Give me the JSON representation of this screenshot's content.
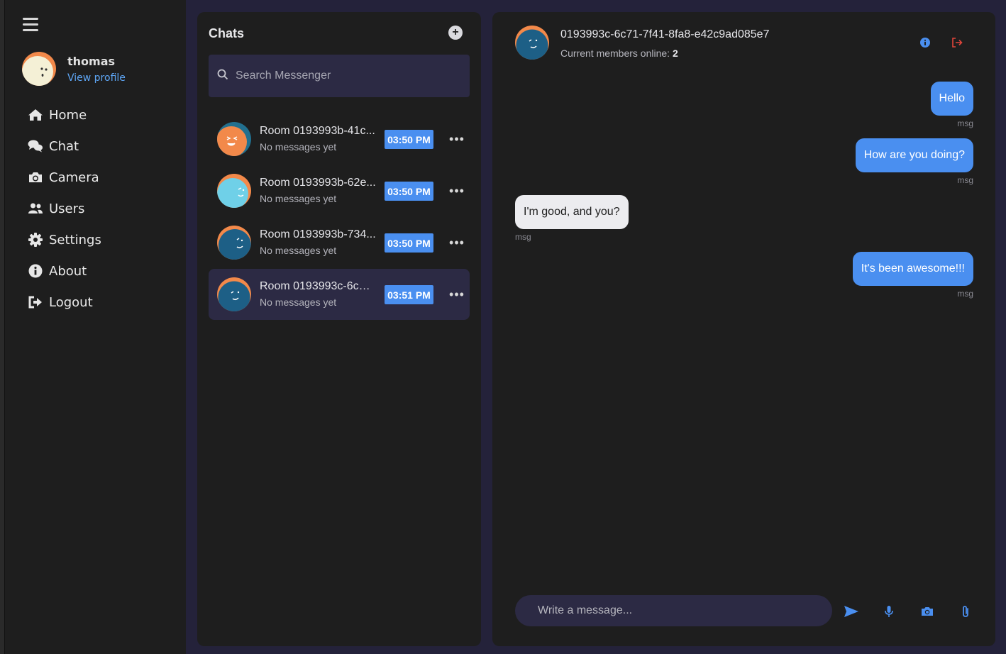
{
  "sidebar": {
    "profile": {
      "name": "thomas",
      "link": "View profile"
    },
    "nav": [
      {
        "label": "Home",
        "icon": "home-icon"
      },
      {
        "label": "Chat",
        "icon": "chat-icon"
      },
      {
        "label": "Camera",
        "icon": "camera-icon"
      },
      {
        "label": "Users",
        "icon": "users-icon"
      },
      {
        "label": "Settings",
        "icon": "gear-icon"
      },
      {
        "label": "About",
        "icon": "info-icon"
      },
      {
        "label": "Logout",
        "icon": "logout-icon"
      }
    ]
  },
  "chats": {
    "title": "Chats",
    "add_symbol": "+",
    "search_placeholder": "Search Messenger",
    "rooms": [
      {
        "name": "Room 0193993b-41c...",
        "subtitle": "No messages yet",
        "time": "03:50 PM",
        "active": false,
        "more": "•••"
      },
      {
        "name": "Room 0193993b-62e...",
        "subtitle": "No messages yet",
        "time": "03:50 PM",
        "active": false,
        "more": "•••"
      },
      {
        "name": "Room 0193993b-734...",
        "subtitle": "No messages yet",
        "time": "03:50 PM",
        "active": false,
        "more": "•••"
      },
      {
        "name": "Room 0193993c-6c71...",
        "subtitle": "No messages yet",
        "time": "03:51 PM",
        "active": true,
        "more": "•••"
      }
    ]
  },
  "conversation": {
    "title": "0193993c-6c71-7f41-8fa8-e42c9ad085e7",
    "online_label": "Current members online:",
    "online_count": "2",
    "messages": [
      {
        "text": "Hello",
        "meta": "msg",
        "side": "right"
      },
      {
        "text": "How are you doing?",
        "meta": "msg",
        "side": "right"
      },
      {
        "text": "I'm good, and you?",
        "meta": "msg",
        "side": "left"
      },
      {
        "text": "It's been awesome!!!",
        "meta": "msg",
        "side": "right"
      }
    ],
    "composer_placeholder": "Write a message..."
  },
  "colors": {
    "accent": "#4a8ff0",
    "panel": "#1e1e1e",
    "background": "#24223a",
    "input": "#2c2a44",
    "danger": "#e0453a"
  }
}
